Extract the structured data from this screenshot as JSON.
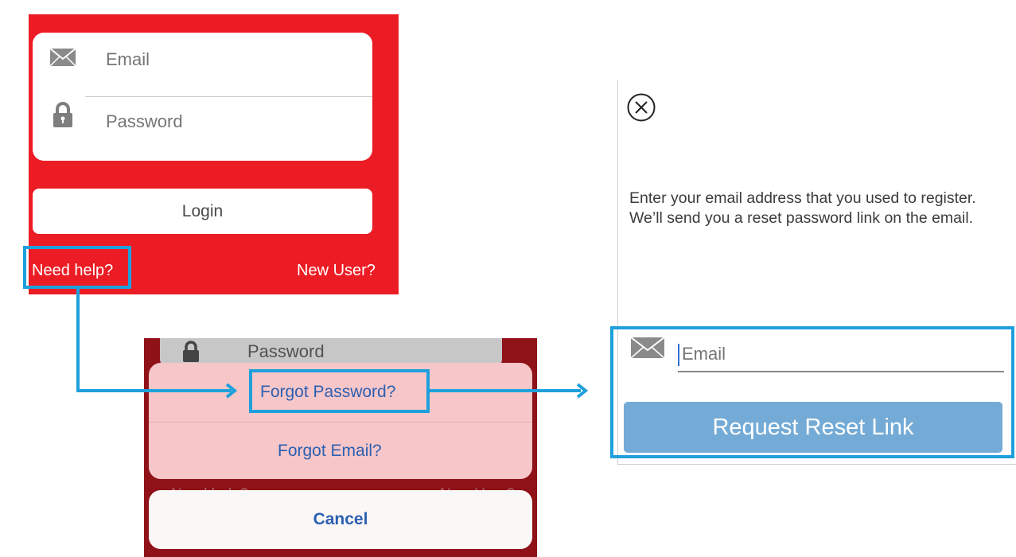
{
  "login": {
    "email_placeholder": "Email",
    "password_placeholder": "Password",
    "login_button": "Login",
    "need_help": "Need help?",
    "new_user": "New User?"
  },
  "sheet": {
    "password_behind": "Password",
    "forgot_password": "Forgot Password?",
    "forgot_email": "Forgot Email?",
    "need_help_behind": "Need help?",
    "new_user_behind": "New User?",
    "cancel": "Cancel"
  },
  "reset": {
    "instructions": "Enter your email address that you used to register. We’ll send you a reset password link on the email.",
    "email_placeholder": "Email",
    "request_button": "Request Reset Link"
  },
  "icons": {
    "email": "envelope-icon",
    "password": "lock-icon",
    "close": "close-circle-icon",
    "arrow": "arrow-right-icon"
  },
  "colors": {
    "brand_red": "#ec1c24",
    "highlight_blue": "#1ea0dc",
    "action_blue": "#2b5fb0",
    "button_blue": "#74abd6"
  }
}
